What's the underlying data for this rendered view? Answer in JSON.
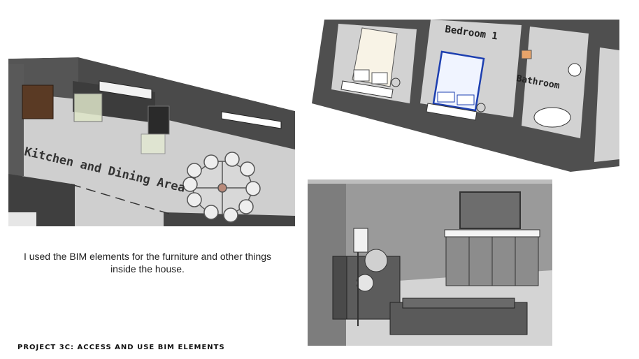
{
  "kitchen_panel": {
    "label": "Kitchen and Dining Area"
  },
  "bedroom_panel": {
    "bedroom_label": "Bedroom 1",
    "bathroom_label": "Bathroom"
  },
  "living_panel": {},
  "caption": "I used the BIM elements for the furniture and other things inside the house.",
  "footer": "PROJECT 3C: ACCESS AND USE BIM ELEMENTS"
}
